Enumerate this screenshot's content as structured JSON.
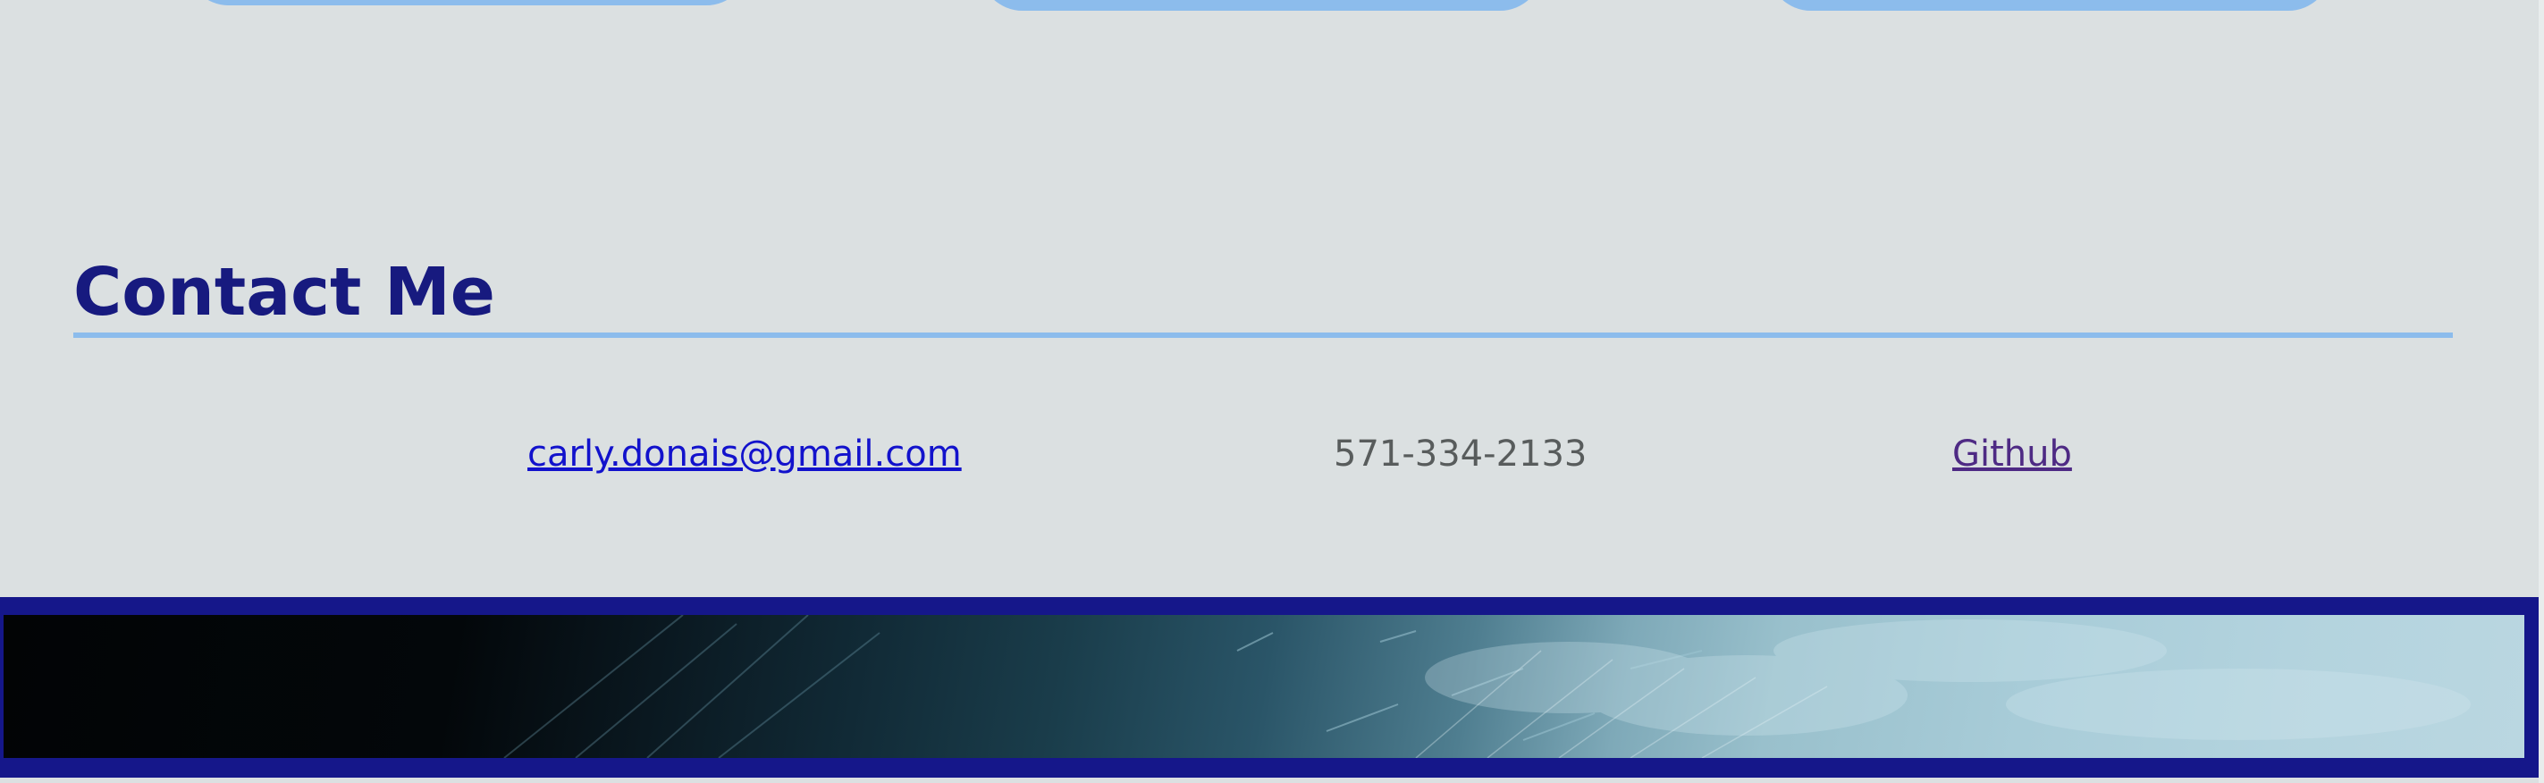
{
  "contact": {
    "title": "Contact Me",
    "email": "carly.donais@gmail.com",
    "phone": "571-334-2133",
    "github_label": "Github"
  },
  "colors": {
    "background": "#dbe0e1",
    "title": "#171a7f",
    "accent": "#8cbcec",
    "email_link": "#1212cc",
    "phone_text": "#585c5c",
    "github_link": "#4e2a84",
    "footer_border": "#15178a"
  },
  "footer": {
    "image": "feather-photo"
  }
}
